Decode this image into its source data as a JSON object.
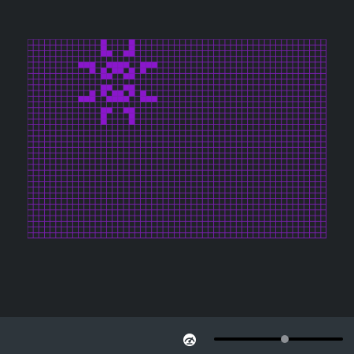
{
  "colors": {
    "background": "#1f2326",
    "grid_line": "#7a1fb0",
    "live_cell": "#8a16cc",
    "bar": "#2d353b",
    "slider_track": "#000000",
    "slider_thumb": "#8e9196"
  },
  "board": {
    "cols": 53,
    "rows": 35,
    "live_cells": [
      [
        13,
        0
      ],
      [
        18,
        0
      ],
      [
        13,
        1
      ],
      [
        18,
        1
      ],
      [
        13,
        2
      ],
      [
        14,
        2
      ],
      [
        17,
        2
      ],
      [
        18,
        2
      ],
      [
        9,
        4
      ],
      [
        10,
        4
      ],
      [
        11,
        4
      ],
      [
        14,
        4
      ],
      [
        15,
        4
      ],
      [
        16,
        4
      ],
      [
        17,
        4
      ],
      [
        20,
        4
      ],
      [
        21,
        4
      ],
      [
        22,
        4
      ],
      [
        11,
        5
      ],
      [
        13,
        5
      ],
      [
        15,
        5
      ],
      [
        16,
        5
      ],
      [
        18,
        5
      ],
      [
        20,
        5
      ],
      [
        13,
        6
      ],
      [
        14,
        6
      ],
      [
        17,
        6
      ],
      [
        18,
        6
      ],
      [
        13,
        8
      ],
      [
        14,
        8
      ],
      [
        17,
        8
      ],
      [
        18,
        8
      ],
      [
        11,
        9
      ],
      [
        13,
        9
      ],
      [
        15,
        9
      ],
      [
        16,
        9
      ],
      [
        18,
        9
      ],
      [
        20,
        9
      ],
      [
        9,
        10
      ],
      [
        10,
        10
      ],
      [
        11,
        10
      ],
      [
        14,
        10
      ],
      [
        15,
        10
      ],
      [
        16,
        10
      ],
      [
        17,
        10
      ],
      [
        20,
        10
      ],
      [
        21,
        10
      ],
      [
        22,
        10
      ],
      [
        13,
        12
      ],
      [
        14,
        12
      ],
      [
        17,
        12
      ],
      [
        18,
        12
      ],
      [
        13,
        13
      ],
      [
        18,
        13
      ],
      [
        13,
        14
      ],
      [
        18,
        14
      ]
    ]
  },
  "controls": {
    "speed_icon": "speedometer-icon",
    "speed_value": 0.55
  }
}
